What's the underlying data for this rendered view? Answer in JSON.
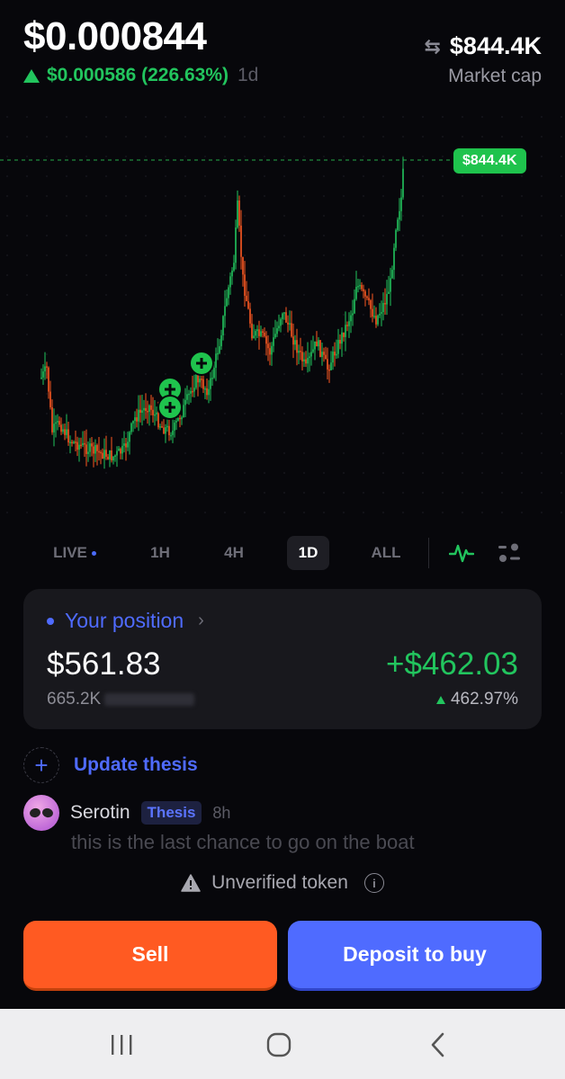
{
  "header": {
    "price": "$0.000844",
    "change": "$0.000586 (226.63%)",
    "period": "1d",
    "market_cap_value": "$844.4K",
    "market_cap_label": "Market cap"
  },
  "chart": {
    "high_badge": "$844.4K"
  },
  "timeframes": [
    {
      "label": "LIVE",
      "active": false
    },
    {
      "label": "1H",
      "active": false
    },
    {
      "label": "4H",
      "active": false
    },
    {
      "label": "1D",
      "active": true
    },
    {
      "label": "ALL",
      "active": false
    }
  ],
  "position": {
    "title": "Your position",
    "value": "$561.83",
    "quantity": "665.2K",
    "pnl": "+$462.03",
    "pnl_pct": "462.97%"
  },
  "thesis": {
    "update_label": "Update thesis"
  },
  "comment": {
    "user": "Serotin",
    "tag": "Thesis",
    "time": "8h",
    "text": "this is the last chance to go on the boat"
  },
  "warning": {
    "text": "Unverified token"
  },
  "actions": {
    "sell": "Sell",
    "buy": "Deposit to buy"
  },
  "colors": {
    "up": "#22c55e",
    "down": "#ff5a22",
    "accent": "#4f6bff"
  }
}
